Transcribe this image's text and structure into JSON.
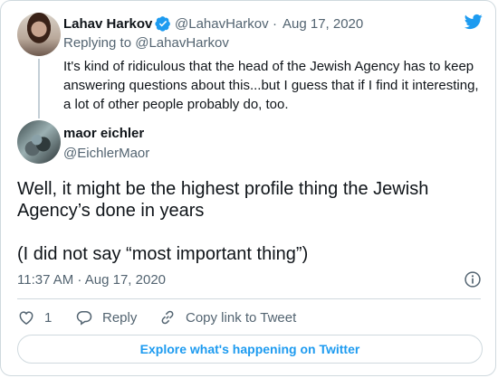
{
  "colors": {
    "accent": "#1d9bf0",
    "muted_text": "#536471",
    "primary_text": "#0f1419",
    "border": "#cfd9de"
  },
  "icons": {
    "brand": "twitter-bird-icon",
    "verified": "verified-badge-icon",
    "info": "info-icon",
    "like": "heart-icon",
    "reply": "reply-icon",
    "copy": "link-icon"
  },
  "parent_tweet": {
    "author_name": "Lahav Harkov",
    "author_handle": "@LahavHarkov",
    "separator": "·",
    "date": "Aug 17, 2020",
    "replying_prefix": "Replying to",
    "replying_handle": "@LahavHarkov",
    "text": "It's kind of ridiculous that the head of the Jewish Agency has to keep answering questions about this...but I guess that if I find it interesting, a lot of other people probably do, too."
  },
  "main_tweet": {
    "author_name": "maor eichler",
    "author_handle": "@EichlerMaor",
    "text_line1": "Well, it might be the highest profile thing the Jewish",
    "text_line2": "Agency’s done in years",
    "text_line3": "(I did not say “most important thing”)",
    "timestamp": "11:37 AM · Aug 17, 2020"
  },
  "actions": {
    "like_count": "1",
    "reply_label": "Reply",
    "copy_label": "Copy link to Tweet"
  },
  "footer": {
    "explore_label": "Explore what's happening on Twitter"
  }
}
